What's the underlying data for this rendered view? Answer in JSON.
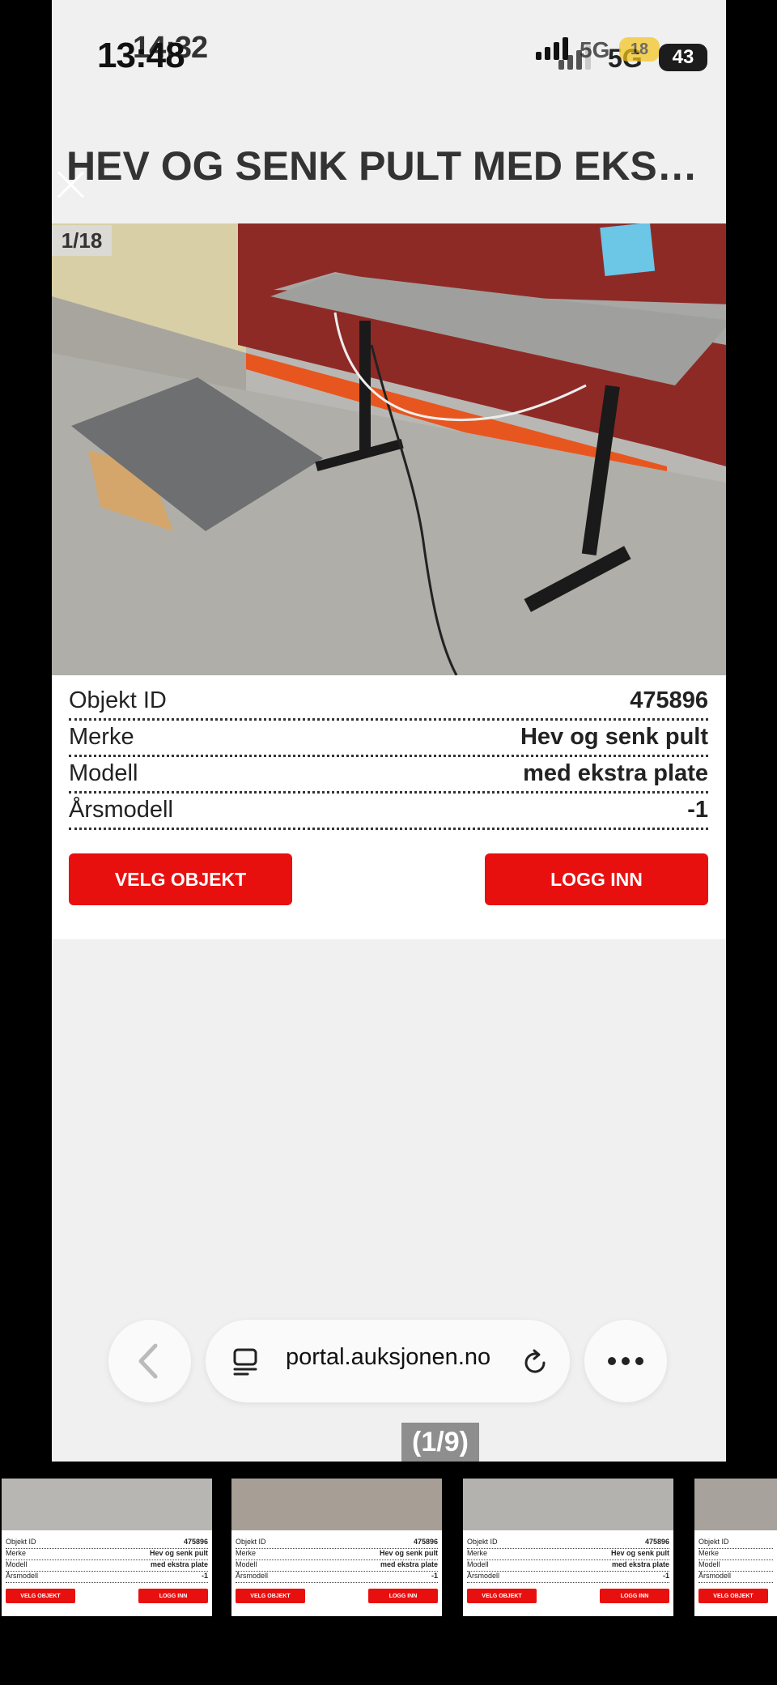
{
  "status_bar": {
    "time_primary": "13:48",
    "time_secondary": "14:32",
    "network_primary": "5G",
    "network_secondary": "5G",
    "battery_primary": "43",
    "battery_secondary": "18"
  },
  "item": {
    "title": "HEV OG SENK PULT MED EKS…",
    "image_counter": "1/18"
  },
  "specs": [
    {
      "label": "Objekt ID",
      "value": "475896"
    },
    {
      "label": "Merke",
      "value": "Hev og senk pult"
    },
    {
      "label": "Modell",
      "value": "med ekstra plate"
    },
    {
      "label": "Årsmodell",
      "value": "-1"
    }
  ],
  "buttons": {
    "select": "VELG OBJEKT",
    "login": "LOGG INN"
  },
  "browser": {
    "url": "portal.auksjonen.no"
  },
  "gallery": {
    "page_counter": "(1/9)"
  },
  "colors": {
    "accent_red": "#e8100f",
    "page_bg": "#f0f0f0"
  }
}
